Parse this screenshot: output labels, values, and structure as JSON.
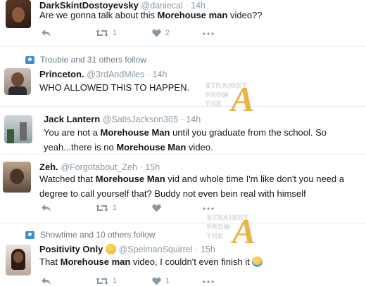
{
  "tweets": [
    {
      "name": "DarkSkintDostoyevsky",
      "handle": "@daniecal",
      "time": "· 14h",
      "text": [
        "Are we gonna talk about this ",
        "Morehouse man",
        " video??"
      ],
      "retweets": "1",
      "likes": "2"
    },
    {
      "social": "Trouble and 31 others follow",
      "name": "Princeton.",
      "handle": "@3rdAndMiles",
      "time": "· 14h",
      "text": [
        "WHO ALLOWED THIS TO HAPPEN."
      ]
    },
    {
      "name": "Jack Lantern",
      "handle": "@SatisJackson305",
      "time": "· 14h",
      "line1": [
        "You are not a ",
        "Morehouse Man",
        " until you graduate from the school. So"
      ],
      "line2": [
        "yeah...there is no ",
        "Morehouse Man",
        " video."
      ]
    },
    {
      "name": "Zeh.",
      "handle": "@Forgotabout_Zeh",
      "time": "· 15h",
      "line1": [
        "Watched that ",
        "Morehouse Man",
        " vid and whole time I'm like don't you need a"
      ],
      "line2": [
        "degree to call yourself that? Buddy not even bein real with himself"
      ],
      "retweets": "1"
    },
    {
      "social": "Showtime and 10 others follow",
      "name": "Positivity Only",
      "handle": "@SpelmanSquirrel",
      "time": "· 15h",
      "text": [
        "That ",
        "Morehouse man",
        " video, I couldn't even finish it"
      ],
      "retweets": "1",
      "likes": "1"
    }
  ],
  "watermark": {
    "line1": "STRAIGHT",
    "line2": "FROM",
    "line3": "THE",
    "letter": "A"
  },
  "colors": {
    "text": "#14171a",
    "muted": "#8899a6",
    "divider": "#e6ecf0",
    "follow_icon": "#3a8fd6",
    "watermark_a": "#e8a52a"
  }
}
